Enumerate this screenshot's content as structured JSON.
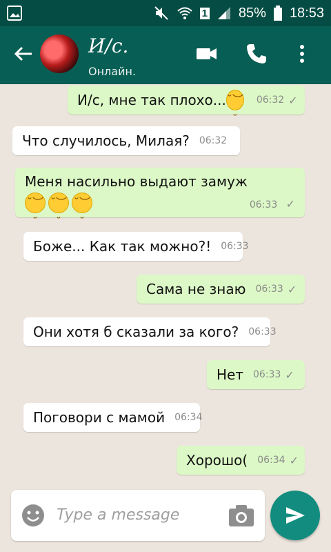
{
  "status_bar": {
    "battery": "85%",
    "time": "18:53",
    "sim": "1"
  },
  "header": {
    "contact_name": "И/с.",
    "contact_status": "Онлайн."
  },
  "messages": [
    {
      "dir": "out",
      "text": "И/с, мне так плохо...",
      "emoji_count": 1,
      "time": "06:32",
      "tick": "✓"
    },
    {
      "dir": "in",
      "text": "Что случилось, Милая?",
      "time": "06:32"
    },
    {
      "dir": "out",
      "text": "Меня насильно выдают замуж",
      "emoji_count": 3,
      "time": "06:33",
      "tick": "✓"
    },
    {
      "dir": "in",
      "text": "Боже... Как так можно?!",
      "time": "06:33"
    },
    {
      "dir": "out",
      "text": "Сама не знаю",
      "time": "06:33",
      "tick": "✓"
    },
    {
      "dir": "in",
      "text": "Они хотя б сказали за кого?",
      "time": "06:33"
    },
    {
      "dir": "out",
      "text": "Нет",
      "time": "06:33",
      "tick": "✓"
    },
    {
      "dir": "in",
      "text": "Поговори с мамой",
      "time": "06:34"
    },
    {
      "dir": "out",
      "text": "Хорошо(",
      "time": "06:34",
      "tick": "✓"
    }
  ],
  "input": {
    "placeholder": "Type a message"
  },
  "colors": {
    "header": "#075e54",
    "status_bar": "#054d44",
    "outgoing_bubble": "#dcf8c6",
    "incoming_bubble": "#ffffff",
    "send_button": "#128c7e"
  }
}
